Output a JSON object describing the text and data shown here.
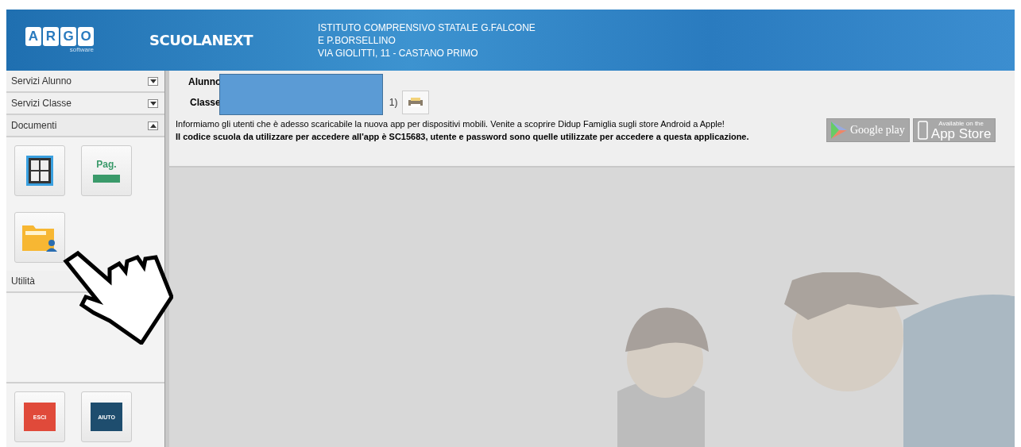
{
  "header": {
    "logo_letters": [
      "A",
      "R",
      "G",
      "O"
    ],
    "logo_sub": "software",
    "product": "SCUOLANEXT",
    "school_lines": [
      "ISTITUTO COMPRENSIVO STATALE G.FALCONE",
      "E P.BORSELLINO",
      "VIA GIOLITTI, 11 - CASTANO PRIMO"
    ]
  },
  "sidebar": {
    "sections": [
      {
        "label": "Servizi Alunno",
        "expanded": false
      },
      {
        "label": "Servizi Classe",
        "expanded": false
      },
      {
        "label": "Documenti",
        "expanded": true,
        "tiles": [
          {
            "kind": "grid"
          },
          {
            "kind": "page",
            "text": "Pag."
          },
          {
            "kind": "folder"
          }
        ]
      },
      {
        "label": "Utilità"
      }
    ],
    "bottom_buttons": [
      {
        "kind": "exit",
        "label": "ESCI"
      },
      {
        "kind": "help",
        "label": "AIUTO"
      }
    ]
  },
  "info": {
    "student_label": "Alunno",
    "class_label": "Classe",
    "class_suffix": "1)",
    "notice": "Informiamo gli utenti che è adesso scaricabile la nuova app per dispositivi mobili. Venite a scoprire Didup Famiglia sugli store Android a Apple!",
    "code_notice": "Il codice scuola da utilizzare per accedere all'app è SC15683, utente e password sono quelle utilizzate per accedere a questa applicazione.",
    "stores": [
      {
        "kind": "google",
        "label": "Google play"
      },
      {
        "kind": "apple",
        "small": "Available on the",
        "label": "App Store"
      }
    ]
  }
}
